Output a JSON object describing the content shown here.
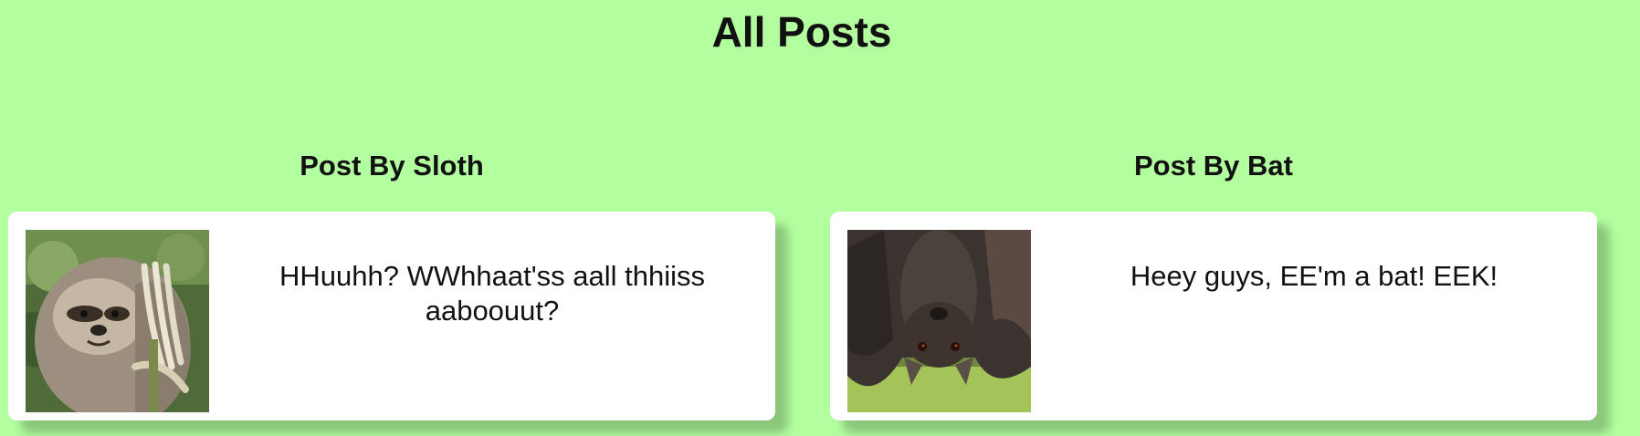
{
  "page": {
    "title": "All Posts"
  },
  "posts": [
    {
      "header": "Post By Sloth",
      "text": "HHuuhh? WWhhaat'ss aall thhiiss aaboouut?",
      "image_icon": "sloth-photo"
    },
    {
      "header": "Post By Bat",
      "text": "Heey guys, EE'm a bat! EEK!",
      "image_icon": "bat-photo"
    }
  ],
  "colors": {
    "background": "#b3fe9f",
    "card": "#ffffff",
    "text": "#111111"
  }
}
